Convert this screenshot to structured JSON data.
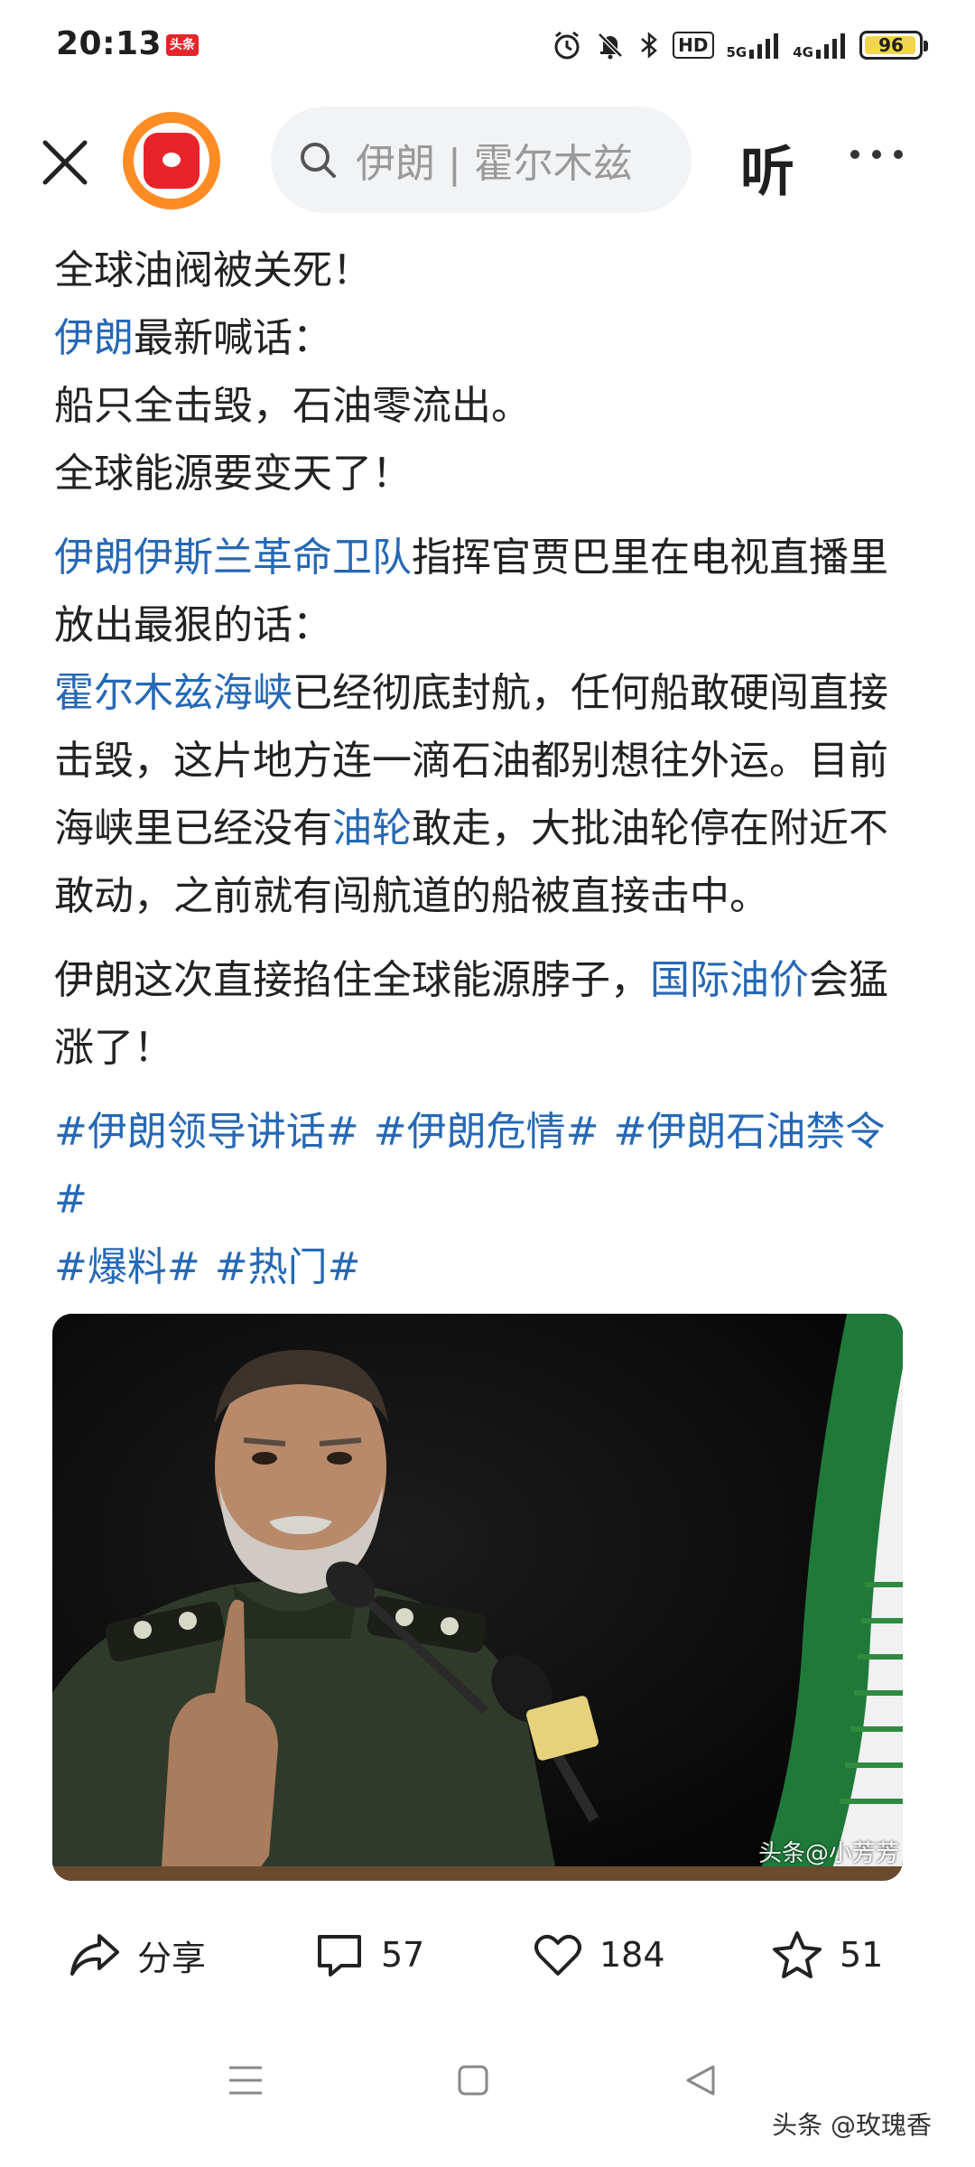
{
  "status_bar": {
    "time": "20:13",
    "app_badge": "头条",
    "network_1": "5G",
    "network_2": "4G",
    "battery": "96",
    "battery_level": 0.96
  },
  "nav": {
    "search_text": "伊朗 | 霍尔木兹",
    "listen_label": "听"
  },
  "article": {
    "line1": "全球油阀被关死！",
    "line2_link": "伊朗",
    "line2_rest": "最新喊话：",
    "line3": "船只全击毁，石油零流出。",
    "line4": "全球能源要变天了！",
    "p2_link": "伊朗伊斯兰革命卫队",
    "p2_rest": "指挥官贾巴里在电视直播里放出最狠的话：",
    "p3_link1": "霍尔木兹海峡",
    "p3_text1": "已经彻底封航，任何船敢硬闯直接击毁，这片地方连一滴石油都别想往外运。目前海峡里已经没有",
    "p3_link2": "油轮",
    "p3_text2": "敢走，大批油轮停在附近不敢动，之前就有闯航道的船被直接击中。",
    "p4_text1": "伊朗这次直接掐住全球能源脖子，",
    "p4_link": "国际油价",
    "p4_text2": "会猛涨了！",
    "hashtags": [
      "#伊朗领导讲话#",
      "#伊朗危情#",
      "#伊朗石油禁令#",
      "#爆料#",
      "#热门#"
    ]
  },
  "image": {
    "watermark": "头条@小芳芳"
  },
  "actions": {
    "share_label": "分享",
    "comment_count": "57",
    "like_count": "184",
    "favorite_count": "51"
  },
  "footer": {
    "watermark": "头条 @玫瑰香"
  },
  "colors": {
    "link": "#2668b5",
    "logo_orange": "#fd8c25",
    "logo_red": "#e8242b"
  }
}
